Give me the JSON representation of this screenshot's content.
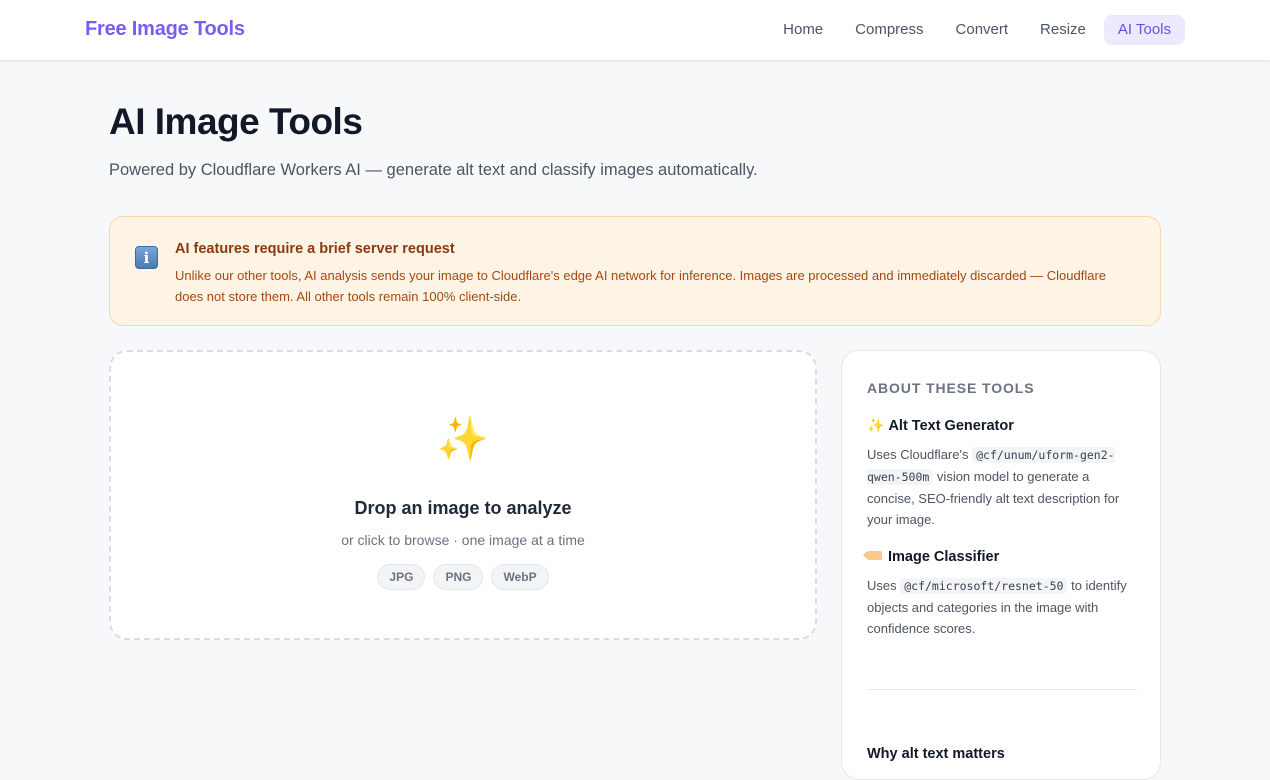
{
  "header": {
    "brand": "Free Image Tools",
    "nav": [
      {
        "label": "Home"
      },
      {
        "label": "Compress"
      },
      {
        "label": "Convert"
      },
      {
        "label": "Resize"
      },
      {
        "label": "AI Tools",
        "active": true
      }
    ]
  },
  "page": {
    "title": "AI Image Tools",
    "subtitle": "Powered by Cloudflare Workers AI — generate alt text and classify images automatically."
  },
  "notice": {
    "icon": "info-icon",
    "title": "AI features require a brief server request",
    "body": "Unlike our other tools, AI analysis sends your image to Cloudflare's edge AI network for inference. Images are processed and immediately discarded — Cloudflare does not store them. All other tools remain 100% client-side."
  },
  "dropzone": {
    "icon": "sparkles-icon",
    "title": "Drop an image to analyze",
    "subtitle": "or click to browse · one image at a time",
    "formats": [
      "JPG",
      "PNG",
      "WebP"
    ]
  },
  "sidebar": {
    "heading": "ABOUT THESE TOOLS",
    "tools": [
      {
        "icon": "sparkles-icon",
        "title": "Alt Text Generator",
        "desc_prefix": "Uses Cloudflare's ",
        "model": "@cf/unum/uform-gen2-qwen-500m",
        "desc_suffix": " vision model to generate a concise, SEO-friendly alt text description for your image."
      },
      {
        "icon": "label-icon",
        "title": "Image Classifier",
        "desc_prefix": "Uses ",
        "model": "@cf/microsoft/resnet-50",
        "desc_suffix": " to identify objects and categories in the image with confidence scores."
      }
    ],
    "why_heading": "Why alt text matters"
  },
  "colors": {
    "brand": "#7c5cf0",
    "nav_active_bg": "#ede9fe",
    "notice_bg": "#fef4e6",
    "notice_text": "#a6480f"
  }
}
